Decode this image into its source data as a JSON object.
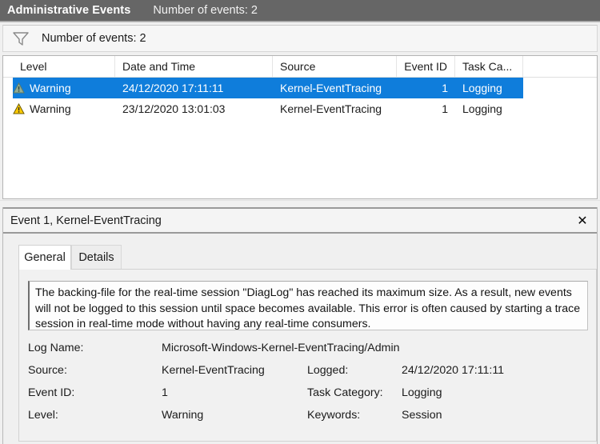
{
  "titlebar": {
    "title": "Administrative Events",
    "count_text": "Number of events: 2"
  },
  "filterbar": {
    "icon": "funnel-icon",
    "label": "Number of events: 2"
  },
  "event_list": {
    "columns": [
      {
        "key": "level",
        "label": "Level",
        "align": "left"
      },
      {
        "key": "datetime",
        "label": "Date and Time",
        "align": "left"
      },
      {
        "key": "source",
        "label": "Source",
        "align": "left"
      },
      {
        "key": "event_id",
        "label": "Event ID",
        "align": "right"
      },
      {
        "key": "task_category",
        "label": "Task Ca...",
        "align": "left"
      }
    ],
    "rows": [
      {
        "icon": "warning-icon",
        "level": "Warning",
        "datetime": "24/12/2020 17:11:11",
        "source": "Kernel-EventTracing",
        "event_id": "1",
        "task_category": "Logging",
        "selected": true
      },
      {
        "icon": "warning-icon",
        "level": "Warning",
        "datetime": "23/12/2020 13:01:03",
        "source": "Kernel-EventTracing",
        "event_id": "1",
        "task_category": "Logging",
        "selected": false
      }
    ]
  },
  "detail": {
    "title": "Event 1, Kernel-EventTracing",
    "close_label": "✕",
    "tabs": [
      {
        "label": "General",
        "active": true
      },
      {
        "label": "Details",
        "active": false
      }
    ],
    "message": "The backing-file for the real-time session \"DiagLog\" has reached its maximum size. As a result, new events will not be logged to this session until space becomes available. This error is often caused by starting a trace session in real-time mode without having any real-time consumers.",
    "properties": {
      "log_name_label": "Log Name:",
      "log_name_value": "Microsoft-Windows-Kernel-EventTracing/Admin",
      "source_label": "Source:",
      "source_value": "Kernel-EventTracing",
      "logged_label": "Logged:",
      "logged_value": "24/12/2020 17:11:11",
      "event_id_label": "Event ID:",
      "event_id_value": "1",
      "task_category_label": "Task Category:",
      "task_category_value": "Logging",
      "level_label": "Level:",
      "level_value": "Warning",
      "keywords_label": "Keywords:",
      "keywords_value": "Session"
    }
  },
  "colors": {
    "titlebar_bg": "#666666",
    "selection_bg": "#0f7ddb",
    "warning_yellow": "#ffcc00",
    "warning_selected": "#8fae93"
  }
}
